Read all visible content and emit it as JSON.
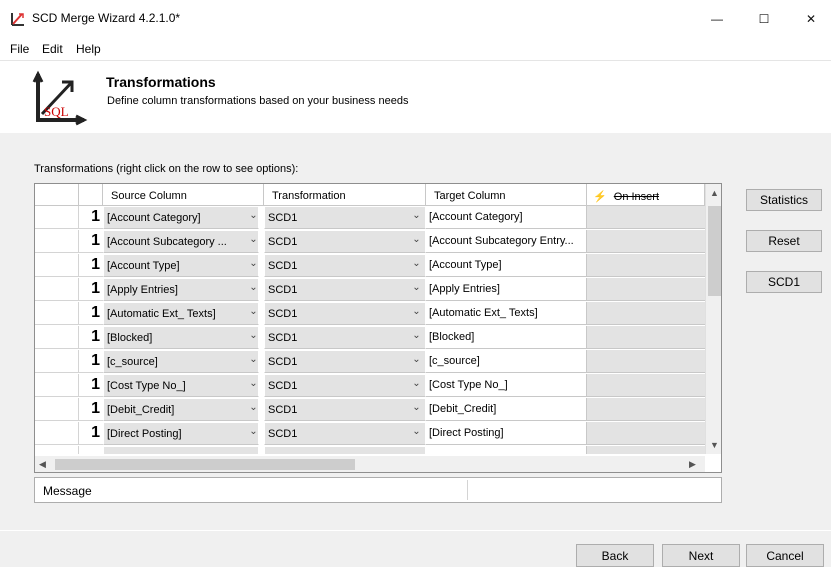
{
  "window": {
    "title": "SCD Merge Wizard 4.2.1.0*",
    "minimize_glyph": "—",
    "maximize_glyph": "☐",
    "close_glyph": "✕"
  },
  "menu": {
    "items": [
      "File",
      "Edit",
      "Help"
    ]
  },
  "header": {
    "title": "Transformations",
    "subtitle": "Define column transformations based on your business needs",
    "logo_text": "SQL"
  },
  "grid": {
    "caption": "Transformations (right click on the row to see options):",
    "columns": {
      "source": "Source Column",
      "transformation": "Transformation",
      "target": "Target Column",
      "on_insert": "On Insert"
    },
    "rows": [
      {
        "key": "1",
        "source": "[Account Category]",
        "transformation": "SCD1",
        "target": "[Account Category]"
      },
      {
        "key": "1",
        "source": "[Account Subcategory ...",
        "transformation": "SCD1",
        "target": "[Account Subcategory Entry..."
      },
      {
        "key": "1",
        "source": "[Account Type]",
        "transformation": "SCD1",
        "target": "[Account Type]"
      },
      {
        "key": "1",
        "source": "[Apply Entries]",
        "transformation": "SCD1",
        "target": "[Apply Entries]"
      },
      {
        "key": "1",
        "source": "[Automatic Ext_ Texts]",
        "transformation": "SCD1",
        "target": "[Automatic Ext_ Texts]"
      },
      {
        "key": "1",
        "source": "[Blocked]",
        "transformation": "SCD1",
        "target": "[Blocked]"
      },
      {
        "key": "1",
        "source": "[c_source]",
        "transformation": "SCD1",
        "target": "[c_source]"
      },
      {
        "key": "1",
        "source": "[Cost Type No_]",
        "transformation": "SCD1",
        "target": "[Cost Type No_]"
      },
      {
        "key": "1",
        "source": "[Debit_Credit]",
        "transformation": "SCD1",
        "target": "[Debit_Credit]"
      },
      {
        "key": "1",
        "source": "[Direct Posting]",
        "transformation": "SCD1",
        "target": "[Direct Posting]"
      }
    ]
  },
  "side_buttons": {
    "statistics": "Statistics",
    "reset": "Reset",
    "scd1": "SCD1"
  },
  "message": {
    "label": "Message"
  },
  "footer": {
    "back": "Back",
    "next": "Next",
    "cancel": "Cancel"
  }
}
